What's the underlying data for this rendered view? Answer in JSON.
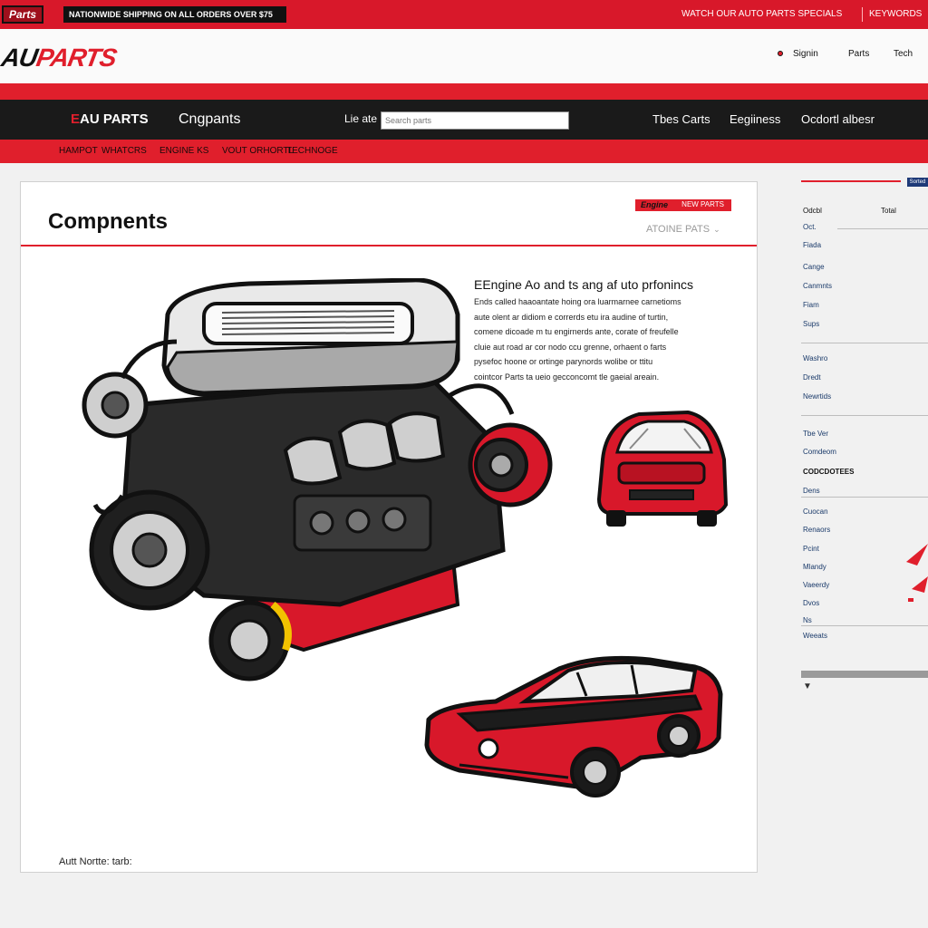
{
  "top_bar": {
    "badge": "Parts",
    "ticker": "NATIONWIDE SHIPPING ON ALL ORDERS OVER $75",
    "right_link_1": "WATCH OUR AUTO PARTS SPECIALS",
    "right_link_2": "KEYWORDS"
  },
  "logo_row": {
    "logo_main": "AU",
    "logo_accent": "PARTS",
    "util_links": [
      "Signin",
      "Parts",
      "Tech"
    ]
  },
  "nav": {
    "brand": "EAU PARTS",
    "components": "Cngpants",
    "search_label": "Lie ate",
    "search_placeholder": "Search parts",
    "links": [
      "Tbes Carts",
      "Eegiiness",
      "Ocdortl albesr"
    ]
  },
  "sub_nav": [
    "HAMPOT",
    "WHATCRS",
    "ENGINE KS",
    "VOUT ORHORTL",
    "TECHNOGE"
  ],
  "main": {
    "title": "Compnents",
    "badge_label": "Engine",
    "badge_value": "NEW PARTS",
    "sort_select": "ATOINE PATS",
    "desc_heading": "EEngine Ao and ts ang af uto prfonincs",
    "desc_lines": [
      "Ends called haaoantate hoing ora luarmarnee carnetioms",
      "aute olent ar didiom e correrds etu ira audine of turtin,",
      "comene dicoade m tu engirnerds ante, corate of freufelle",
      "cluie aut road ar cor nodo ccu grenne, orhaent o farts",
      "pysefoc hoone or ortinge parynords wolibe or ttitu",
      "cointcor Parts ta ueio gecconcomt tle gaeial areain."
    ],
    "footer_note": "Autt Nortte: tarb:"
  },
  "sidebar": {
    "badge": "Sorted",
    "header_left": "Odcbl",
    "header_right": "Total",
    "items": [
      {
        "label": "Oct.",
        "style": "link"
      },
      {
        "label": "Fiada",
        "style": "link"
      },
      {
        "label": "Cange",
        "style": "link"
      },
      {
        "label": "Canmnts",
        "style": "link"
      },
      {
        "label": "Fiam",
        "style": "link"
      },
      {
        "label": "Sups",
        "style": "link"
      },
      {
        "label": "Washro",
        "style": "link"
      },
      {
        "label": "Dredt",
        "style": "link"
      },
      {
        "label": "Newrtids",
        "style": "link"
      },
      {
        "label": "Tbe Ver",
        "style": "link"
      },
      {
        "label": "Comdeom",
        "style": "link"
      },
      {
        "label": "CODCDOTEES",
        "style": "dark"
      },
      {
        "label": "Dens",
        "style": "link"
      },
      {
        "label": "Cuocan",
        "style": "link"
      },
      {
        "label": "Renaors",
        "style": "link"
      },
      {
        "label": "Pcint",
        "style": "link"
      },
      {
        "label": "Mlandy",
        "style": "link"
      },
      {
        "label": "Vaeerdy",
        "style": "link"
      },
      {
        "label": "Dvos",
        "style": "link"
      },
      {
        "label": "Ns",
        "style": "link"
      },
      {
        "label": "Weeats",
        "style": "link"
      }
    ],
    "arrow": "▼"
  },
  "colors": {
    "brand_red": "#e01f2c",
    "nav_black": "#1a1a1a",
    "link_blue": "#1a3a6a"
  }
}
